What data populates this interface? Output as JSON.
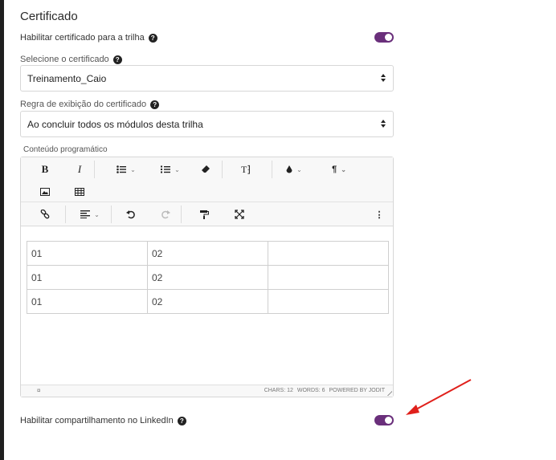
{
  "section_title": "Certificado",
  "enable_certificate": {
    "label": "Habilitar certificado para a trilha",
    "enabled": true
  },
  "certificate_select": {
    "label": "Selecione o certificado",
    "value": "Treinamento_Caio"
  },
  "display_rule_select": {
    "label": "Regra de exibição do certificado",
    "value": "Ao concluir todos os módulos desta trilha"
  },
  "editor": {
    "label": "Conteúdo programático",
    "toolbar": {
      "bold": "B",
      "italic": "I",
      "font": "T⁆",
      "paragraph": "¶",
      "more": "⋮"
    },
    "table": [
      [
        "01",
        "02",
        ""
      ],
      [
        "01",
        "02",
        ""
      ],
      [
        "01",
        "02",
        ""
      ]
    ],
    "status": {
      "chars": "CHARS: 12",
      "words": "WORDS: 6",
      "powered": "POWERED BY JODIT",
      "symbol": "¤"
    }
  },
  "linkedin_share": {
    "label": "Habilitar compartilhamento no LinkedIn",
    "enabled": true
  },
  "accent_color": "#6a2f7b",
  "annotation_color": "#e0201b"
}
